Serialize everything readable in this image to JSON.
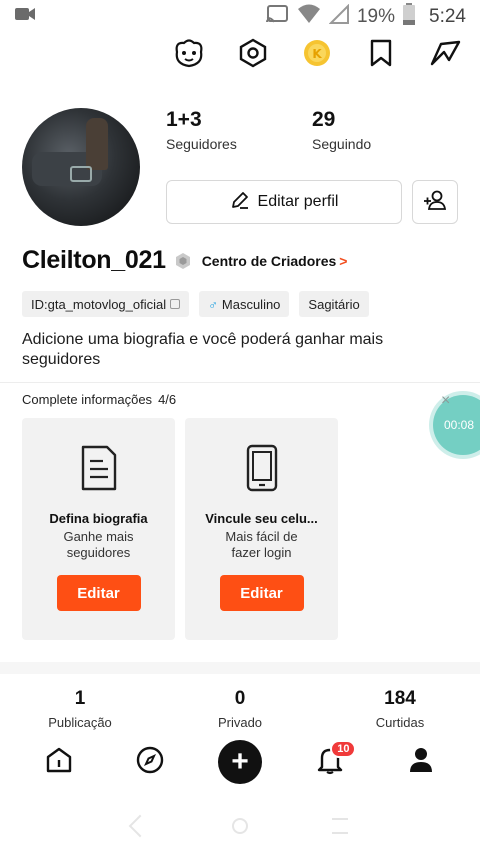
{
  "status_bar": {
    "battery_pct": "19%",
    "clock": "5:24",
    "icons": [
      "video-call-icon",
      "cast-icon",
      "wifi-icon",
      "signal-icon",
      "battery-icon"
    ]
  },
  "top_actions": {
    "icons": [
      "mascot-icon",
      "settings-hex-icon",
      "coin-icon",
      "bookmark-icon",
      "share-icon"
    ]
  },
  "profile": {
    "followers_count": "1+3",
    "followers_label": "Seguidores",
    "following_count": "29",
    "following_label": "Seguindo",
    "edit_profile_label": "Editar perfil",
    "username": "Cleilton_021",
    "creator_center_label": "Centro de Criadores",
    "creator_center_arrow": ">",
    "tags": {
      "id": "ID:gta_motovlog_oficial",
      "gender_symbol": "♂",
      "gender": "Masculino",
      "sign": "Sagitário"
    },
    "bio": "Adicione uma biografia e você poderá ganhar mais seguidores"
  },
  "complete_info": {
    "title": "Complete informações",
    "progress": "4/6",
    "cards": [
      {
        "title": "Defina biografia",
        "sub1": "Ganhe mais",
        "sub2": "seguidores",
        "button": "Editar",
        "icon": "document-icon"
      },
      {
        "title": "Vincule seu celu...",
        "sub1": "Mais fácil de",
        "sub2": "fazer  login",
        "button": "Editar",
        "icon": "phone-icon"
      }
    ]
  },
  "timer": {
    "text": "00:08",
    "close": "×"
  },
  "stats": [
    {
      "num": "1",
      "label": "Publicação"
    },
    {
      "num": "0",
      "label": "Privado"
    },
    {
      "num": "184",
      "label": "Curtidas"
    }
  ],
  "bottom_nav": {
    "plus": "+",
    "notif_badge": "10"
  },
  "colors": {
    "accent": "#fe4f14",
    "badge": "#f03a3a",
    "timer": "#74cfc3",
    "gender": "#1ea0e0"
  }
}
